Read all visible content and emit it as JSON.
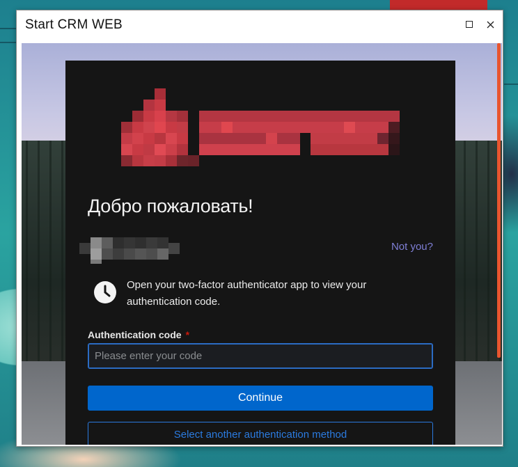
{
  "window": {
    "title": "Start CRM WEB",
    "maximize_icon": "maximize-icon",
    "close_icon": "close-icon"
  },
  "login": {
    "heading": "Добро пожаловать!",
    "not_you": "Not you?",
    "hint_icon": "clock-icon",
    "hint": "Open your two-factor authenticator app to view your authentication code.",
    "code_label": "Authentication code",
    "required_marker": "*",
    "code_value": "",
    "code_placeholder": "Please enter your code",
    "continue_label": "Continue",
    "alt_method_label": "Select another authentication method"
  },
  "colors": {
    "card_bg": "#151515",
    "primary": "#0066cc",
    "link": "#7f7fd6",
    "required": "#c9190b",
    "logo_red": "#c83a44"
  }
}
